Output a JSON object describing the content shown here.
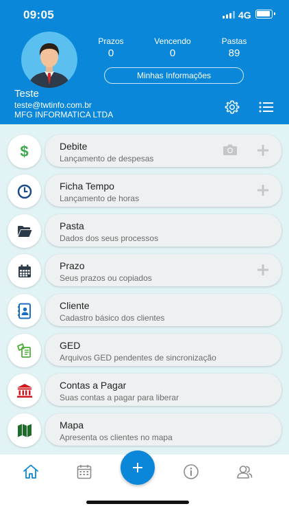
{
  "status_bar": {
    "time": "09:05",
    "network": "4G"
  },
  "profile": {
    "name": "Teste",
    "email": "teste@twtinfo.com.br",
    "company": "MFG INFORMATICA LTDA",
    "stats": [
      {
        "label": "Prazos",
        "value": "0"
      },
      {
        "label": "Vencendo",
        "value": "0"
      },
      {
        "label": "Pastas",
        "value": "89"
      }
    ],
    "info_button_label": "Minhas Informações"
  },
  "menu": [
    {
      "title": "Debite",
      "subtitle": "Lançamento de despesas",
      "icon": "dollar-icon",
      "has_camera": true,
      "has_plus": true
    },
    {
      "title": "Ficha Tempo",
      "subtitle": "Lançamento de horas",
      "icon": "clock-icon",
      "has_camera": false,
      "has_plus": true
    },
    {
      "title": "Pasta",
      "subtitle": "Dados dos seus processos",
      "icon": "folder-icon",
      "has_camera": false,
      "has_plus": false
    },
    {
      "title": "Prazo",
      "subtitle": "Seus prazos ou copiados",
      "icon": "calendar-icon",
      "has_camera": false,
      "has_plus": true
    },
    {
      "title": "Cliente",
      "subtitle": "Cadastro básico dos clientes",
      "icon": "contacts-icon",
      "has_camera": false,
      "has_plus": false
    },
    {
      "title": "GED",
      "subtitle": "Arquivos GED pendentes de sincronização",
      "icon": "documents-icon",
      "has_camera": false,
      "has_plus": false
    },
    {
      "title": "Contas a Pagar",
      "subtitle": "Suas contas a pagar para liberar",
      "icon": "bank-icon",
      "has_camera": false,
      "has_plus": false
    },
    {
      "title": "Mapa",
      "subtitle": "Apresenta os clientes no mapa",
      "icon": "map-icon",
      "has_camera": false,
      "has_plus": false
    }
  ],
  "tab_bar": {
    "items": [
      {
        "name": "home-tab",
        "icon": "home-icon",
        "active": true
      },
      {
        "name": "calendar-tab",
        "icon": "calendar-icon",
        "active": false
      },
      {
        "name": "add-tab",
        "icon": "plus-icon",
        "active": false
      },
      {
        "name": "info-tab",
        "icon": "info-icon",
        "active": false
      },
      {
        "name": "users-tab",
        "icon": "users-icon",
        "active": false
      }
    ]
  },
  "colors": {
    "header": "#0a87d9",
    "background": "#e2f3f6",
    "card": "#eef1f2",
    "dollar": "#3aaa4a",
    "clock": "#1a4a8a",
    "ged": "#4caf3a",
    "bank": "#d0161d",
    "map": "#1e6b2a",
    "icon_gray": "#c4c7ca"
  }
}
